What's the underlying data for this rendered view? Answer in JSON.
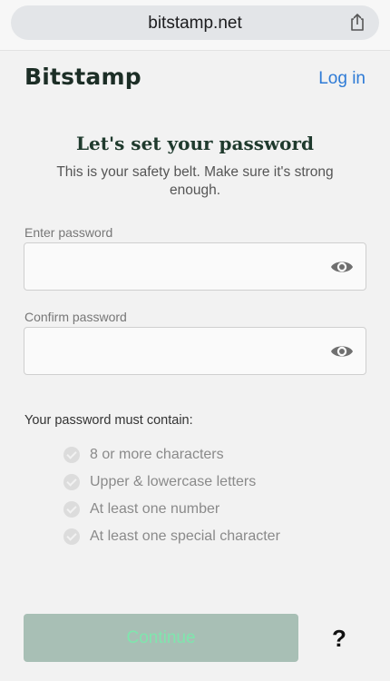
{
  "browser": {
    "url": "bitstamp.net",
    "share_icon": "share-icon"
  },
  "header": {
    "logo": "Bitstamp",
    "login_label": "Log in"
  },
  "main": {
    "title": "Let's set your password",
    "subtitle": "This is your safety belt. Make sure it's strong enough."
  },
  "form": {
    "password": {
      "label": "Enter password",
      "value": "",
      "placeholder": "",
      "toggle_icon": "eye-icon"
    },
    "confirm": {
      "label": "Confirm password",
      "value": "",
      "placeholder": "",
      "toggle_icon": "eye-icon"
    }
  },
  "requirements": {
    "title": "Your password must contain:",
    "items": [
      {
        "label": "8 or more characters",
        "met": false
      },
      {
        "label": "Upper & lowercase letters",
        "met": false
      },
      {
        "label": "At least one number",
        "met": false
      },
      {
        "label": "At least one special character",
        "met": false
      }
    ]
  },
  "footer": {
    "continue_label": "Continue",
    "help_label": "?"
  },
  "colors": {
    "brand_dark": "#1f3a2d",
    "link": "#2e7bd6",
    "button_disabled_bg": "#a8bfb5",
    "button_disabled_text": "#7fe6ad"
  }
}
